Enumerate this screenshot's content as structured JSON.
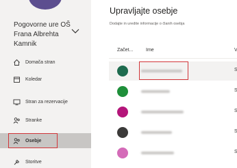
{
  "sidebar": {
    "business_name": "Pogovorne ure OŠ Frana Albrehta Kamnik",
    "nav": [
      {
        "label": "Domača stran",
        "icon": "home-icon"
      },
      {
        "label": "Koledar",
        "icon": "calendar-icon"
      },
      {
        "label": "Stran za rezervacije",
        "icon": "monitor-icon"
      },
      {
        "label": "Stranke",
        "icon": "people-icon"
      },
      {
        "label": "Osebje",
        "icon": "staff-icon"
      },
      {
        "label": "Storitve",
        "icon": "wrench-icon"
      }
    ],
    "active_item": "Osebje"
  },
  "main": {
    "title": "Upravljajte osebje",
    "subtitle": "Dodajte in uredite informacije o članih osebja",
    "columns": {
      "initials": "Začet...",
      "name": "Ime",
      "third": "Vl"
    },
    "rows": [
      {
        "color": "#1e6b4e",
        "col3": "Sk"
      },
      {
        "color": "#1e8f3a",
        "col3": "Sk"
      },
      {
        "color": "#b4157a",
        "col3": "Sk"
      },
      {
        "color": "#3b3a39",
        "col3": "Sk"
      },
      {
        "color": "#d46bb8",
        "col3": "Sk"
      }
    ]
  },
  "colors": {
    "highlight_border": "#d13438",
    "sidebar_bg": "#f3f2f1",
    "active_bg": "#c8c6c4"
  }
}
